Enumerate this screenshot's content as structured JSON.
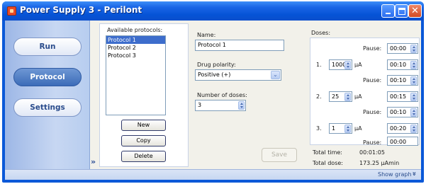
{
  "window": {
    "title": "Power Supply 3 - Perilont"
  },
  "nav": {
    "run": "Run",
    "protocol": "Protocol",
    "settings": "Settings",
    "expand": "»"
  },
  "protocols": {
    "header": "Available protocols:",
    "items": [
      "Protocol 1",
      "Protocol 2",
      "Protocol 3"
    ],
    "selected_index": 0,
    "new_label": "New",
    "copy_label": "Copy",
    "delete_label": "Delete"
  },
  "editor": {
    "name_label": "Name:",
    "name_value": "Protocol 1",
    "polarity_label": "Drug polarity:",
    "polarity_value": "Positive (+)",
    "num_doses_label": "Number of doses:",
    "num_doses_value": "3",
    "save_label": "Save"
  },
  "doses": {
    "header": "Doses:",
    "pause_label": "Pause:",
    "unit": "µA",
    "pause_0": "00:00",
    "rows": [
      {
        "num": "1.",
        "current": "1000",
        "time": "00:10",
        "pause": "00:10"
      },
      {
        "num": "2.",
        "current": "25",
        "time": "00:15",
        "pause": "00:10"
      },
      {
        "num": "3.",
        "current": "1",
        "time": "00:20",
        "pause": "00:00"
      }
    ]
  },
  "totals": {
    "time_label": "Total time:",
    "time_value": "00:01:05",
    "dose_label": "Total dose:",
    "dose_value": "173.25 µAmin"
  },
  "status": {
    "show_graph": "Show graph",
    "arrow": "≚"
  },
  "colors": {
    "titlebar": "#0553d6",
    "selection": "#3d6dcc",
    "nav_active": "#3c6cb8"
  }
}
